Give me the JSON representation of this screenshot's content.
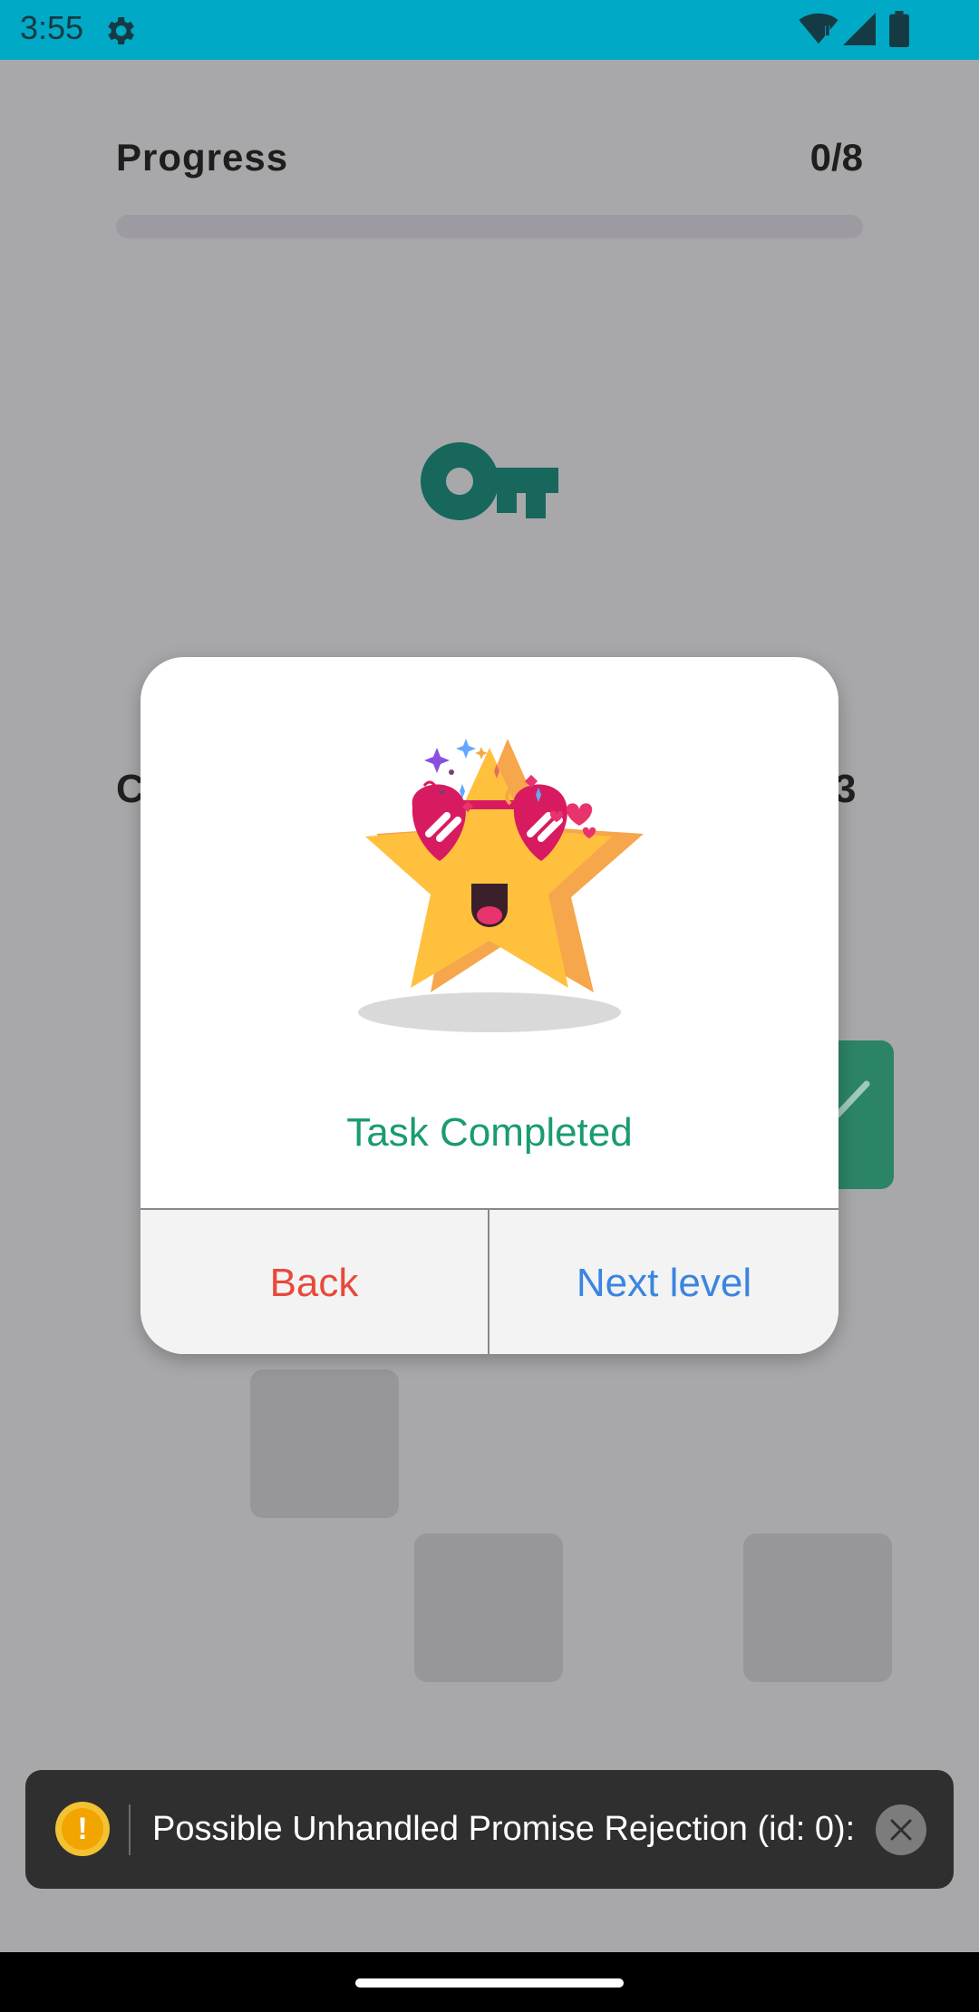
{
  "status_bar": {
    "time": "3:55",
    "icons": [
      "gear-icon",
      "wifi-icon",
      "signal-icon",
      "battery-icon"
    ]
  },
  "screen": {
    "progress_label": "Progress",
    "progress_count": "0/8",
    "progress_fraction": 0,
    "center_icon": "key-icon",
    "obscured_left_text": "C",
    "obscured_right_text": "3"
  },
  "dialog": {
    "title": "Task Completed",
    "back_label": "Back",
    "next_label": "Next level",
    "illustration": "celebrating-star-with-heart-sunglasses"
  },
  "toast": {
    "icon": "warning-icon",
    "message": "Possible Unhandled Promise Rejection (id: 0):",
    "close_icon": "close-icon"
  },
  "colors": {
    "status_bar": "#00a9c6",
    "scrim": "#a8a8aa",
    "accent_green": "#1a9b72",
    "back_red": "#e8493a",
    "next_blue": "#3b84e0",
    "key_teal": "#17675d"
  }
}
